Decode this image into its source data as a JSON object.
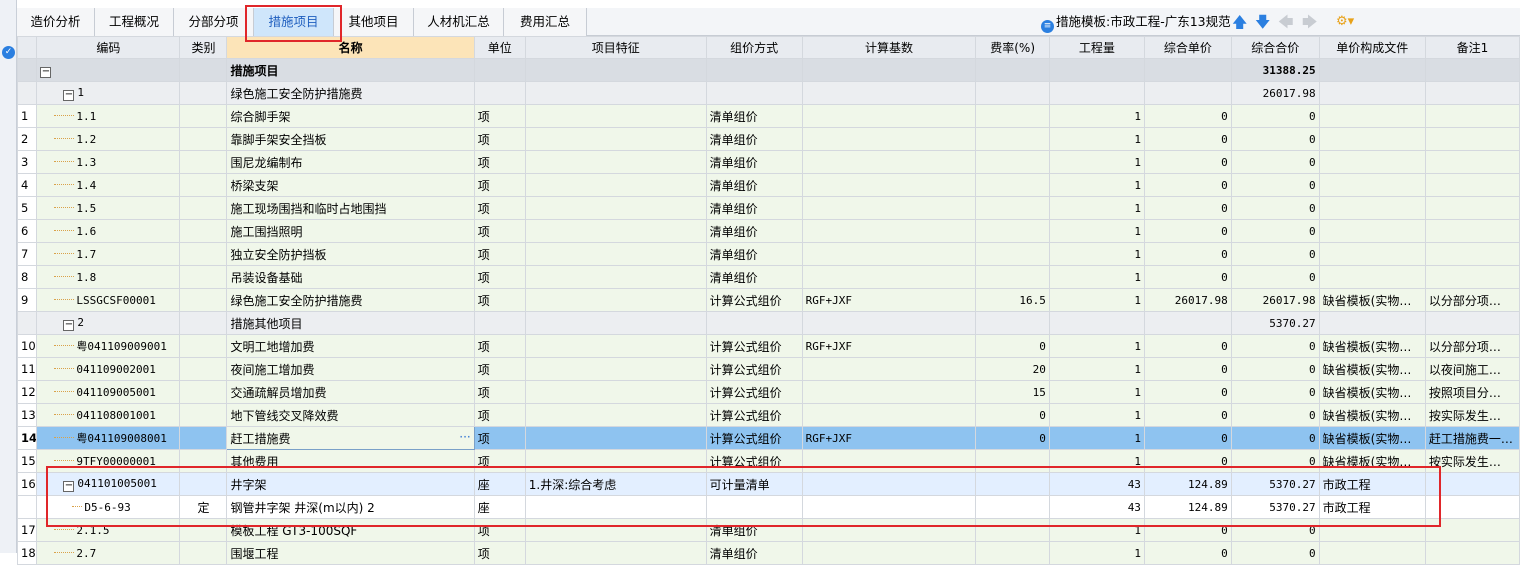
{
  "tabs": [
    {
      "label": "造价分析"
    },
    {
      "label": "工程概况"
    },
    {
      "label": "分部分项"
    },
    {
      "label": "措施项目"
    },
    {
      "label": "其他项目"
    },
    {
      "label": "人材机汇总"
    },
    {
      "label": "费用汇总"
    }
  ],
  "active_tab": "措施项目",
  "template": {
    "label": "措施模板:市政工程-广东13规范"
  },
  "columns": [
    "编码",
    "类别",
    "名称",
    "单位",
    "项目特征",
    "组价方式",
    "计算基数",
    "费率(%)",
    "工程量",
    "综合单价",
    "综合合价",
    "单价构成文件",
    "备注1"
  ],
  "rows": [
    {
      "kind": "top",
      "rn": "",
      "code": "",
      "cat": "",
      "name": "措施项目",
      "unit": "",
      "feat": "",
      "method": "",
      "base": "",
      "rate": "",
      "qty": "",
      "price": "",
      "total": "31388.25",
      "file": "",
      "note": ""
    },
    {
      "kind": "grp",
      "rn": "",
      "code": "1",
      "cat": "",
      "name": "绿色施工安全防护措施费",
      "unit": "",
      "feat": "",
      "method": "",
      "base": "",
      "rate": "",
      "qty": "",
      "price": "",
      "total": "26017.98",
      "file": "",
      "note": ""
    },
    {
      "kind": "item",
      "rn": "1",
      "code": "1.1",
      "cat": "",
      "name": "综合脚手架",
      "unit": "项",
      "feat": "",
      "method": "清单组价",
      "base": "",
      "rate": "",
      "qty": "1",
      "price": "0",
      "total": "0",
      "file": "",
      "note": ""
    },
    {
      "kind": "item",
      "rn": "2",
      "code": "1.2",
      "cat": "",
      "name": "靠脚手架安全挡板",
      "unit": "项",
      "feat": "",
      "method": "清单组价",
      "base": "",
      "rate": "",
      "qty": "1",
      "price": "0",
      "total": "0",
      "file": "",
      "note": ""
    },
    {
      "kind": "item",
      "rn": "3",
      "code": "1.3",
      "cat": "",
      "name": "围尼龙编制布",
      "unit": "项",
      "feat": "",
      "method": "清单组价",
      "base": "",
      "rate": "",
      "qty": "1",
      "price": "0",
      "total": "0",
      "file": "",
      "note": ""
    },
    {
      "kind": "item",
      "rn": "4",
      "code": "1.4",
      "cat": "",
      "name": "桥梁支架",
      "unit": "项",
      "feat": "",
      "method": "清单组价",
      "base": "",
      "rate": "",
      "qty": "1",
      "price": "0",
      "total": "0",
      "file": "",
      "note": ""
    },
    {
      "kind": "item",
      "rn": "5",
      "code": "1.5",
      "cat": "",
      "name": "施工现场围挡和临时占地围挡",
      "unit": "项",
      "feat": "",
      "method": "清单组价",
      "base": "",
      "rate": "",
      "qty": "1",
      "price": "0",
      "total": "0",
      "file": "",
      "note": ""
    },
    {
      "kind": "item",
      "rn": "6",
      "code": "1.6",
      "cat": "",
      "name": "施工围挡照明",
      "unit": "项",
      "feat": "",
      "method": "清单组价",
      "base": "",
      "rate": "",
      "qty": "1",
      "price": "0",
      "total": "0",
      "file": "",
      "note": ""
    },
    {
      "kind": "item",
      "rn": "7",
      "code": "1.7",
      "cat": "",
      "name": "独立安全防护挡板",
      "unit": "项",
      "feat": "",
      "method": "清单组价",
      "base": "",
      "rate": "",
      "qty": "1",
      "price": "0",
      "total": "0",
      "file": "",
      "note": ""
    },
    {
      "kind": "item",
      "rn": "8",
      "code": "1.8",
      "cat": "",
      "name": "吊装设备基础",
      "unit": "项",
      "feat": "",
      "method": "清单组价",
      "base": "",
      "rate": "",
      "qty": "1",
      "price": "0",
      "total": "0",
      "file": "",
      "note": ""
    },
    {
      "kind": "item",
      "rn": "9",
      "code": "LSSGCSF00001",
      "cat": "",
      "name": "绿色施工安全防护措施费",
      "unit": "项",
      "feat": "",
      "method": "计算公式组价",
      "base": "RGF+JXF",
      "rate": "16.5",
      "qty": "1",
      "price": "26017.98",
      "total": "26017.98",
      "file": "缺省模板(实物…",
      "note": "以分部分项…"
    },
    {
      "kind": "grp",
      "rn": "",
      "code": "2",
      "cat": "",
      "name": "措施其他项目",
      "unit": "",
      "feat": "",
      "method": "",
      "base": "",
      "rate": "",
      "qty": "",
      "price": "",
      "total": "5370.27",
      "file": "",
      "note": ""
    },
    {
      "kind": "item",
      "rn": "10",
      "code": "粤041109009001",
      "cat": "",
      "name": "文明工地增加费",
      "unit": "项",
      "feat": "",
      "method": "计算公式组价",
      "base": "RGF+JXF",
      "rate": "0",
      "qty": "1",
      "price": "0",
      "total": "0",
      "file": "缺省模板(实物…",
      "note": "以分部分项…"
    },
    {
      "kind": "item",
      "rn": "11",
      "code": "041109002001",
      "cat": "",
      "name": "夜间施工增加费",
      "unit": "项",
      "feat": "",
      "method": "计算公式组价",
      "base": "",
      "rate": "20",
      "qty": "1",
      "price": "0",
      "total": "0",
      "file": "缺省模板(实物…",
      "note": "以夜间施工…"
    },
    {
      "kind": "item",
      "rn": "12",
      "code": "041109005001",
      "cat": "",
      "name": "交通疏解员增加费",
      "unit": "项",
      "feat": "",
      "method": "计算公式组价",
      "base": "",
      "rate": "15",
      "qty": "1",
      "price": "0",
      "total": "0",
      "file": "缺省模板(实物…",
      "note": "按照项目分…"
    },
    {
      "kind": "item",
      "rn": "13",
      "code": "041108001001",
      "cat": "",
      "name": "地下管线交叉降效费",
      "unit": "项",
      "feat": "",
      "method": "计算公式组价",
      "base": "",
      "rate": "0",
      "qty": "1",
      "price": "0",
      "total": "0",
      "file": "缺省模板(实物…",
      "note": "按实际发生…"
    },
    {
      "kind": "sel",
      "rn": "14",
      "code": "粤041109008001",
      "cat": "",
      "name": "赶工措施费",
      "unit": "项",
      "feat": "",
      "method": "计算公式组价",
      "base": "RGF+JXF",
      "rate": "0",
      "qty": "1",
      "price": "0",
      "total": "0",
      "file": "缺省模板(实物…",
      "note": "赶工措施费一…"
    },
    {
      "kind": "item",
      "rn": "15",
      "code": "9TFY00000001",
      "cat": "",
      "name": "其他费用",
      "unit": "项",
      "feat": "",
      "method": "计算公式组价",
      "base": "",
      "rate": "",
      "qty": "1",
      "price": "0",
      "total": "0",
      "file": "缺省模板(实物…",
      "note": "按实际发生…"
    },
    {
      "kind": "sub",
      "rn": "16",
      "code": "041101005001",
      "cat": "",
      "name": "井字架",
      "unit": "座",
      "feat": "1.井深:综合考虑",
      "method": "可计量清单",
      "base": "",
      "rate": "",
      "qty": "43",
      "price": "124.89",
      "total": "5370.27",
      "file": "市政工程",
      "note": ""
    },
    {
      "kind": "child",
      "rn": "",
      "code": "D5-6-93",
      "cat": "定",
      "name": "钢管井字架 井深(m以内) 2",
      "unit": "座",
      "feat": "",
      "method": "",
      "base": "",
      "rate": "",
      "qty": "43",
      "price": "124.89",
      "total": "5370.27",
      "file": "市政工程",
      "note": ""
    },
    {
      "kind": "item",
      "rn": "17",
      "code": "2.1.5",
      "cat": "",
      "name": "模板工程 GT3-100SQF",
      "unit": "项",
      "feat": "",
      "method": "清单组价",
      "base": "",
      "rate": "",
      "qty": "1",
      "price": "0",
      "total": "0",
      "file": "",
      "note": ""
    },
    {
      "kind": "item",
      "rn": "18",
      "code": "2.7",
      "cat": "",
      "name": "围堰工程",
      "unit": "项",
      "feat": "",
      "method": "清单组价",
      "base": "",
      "rate": "",
      "qty": "1",
      "price": "0",
      "total": "0",
      "file": "",
      "note": ""
    }
  ]
}
